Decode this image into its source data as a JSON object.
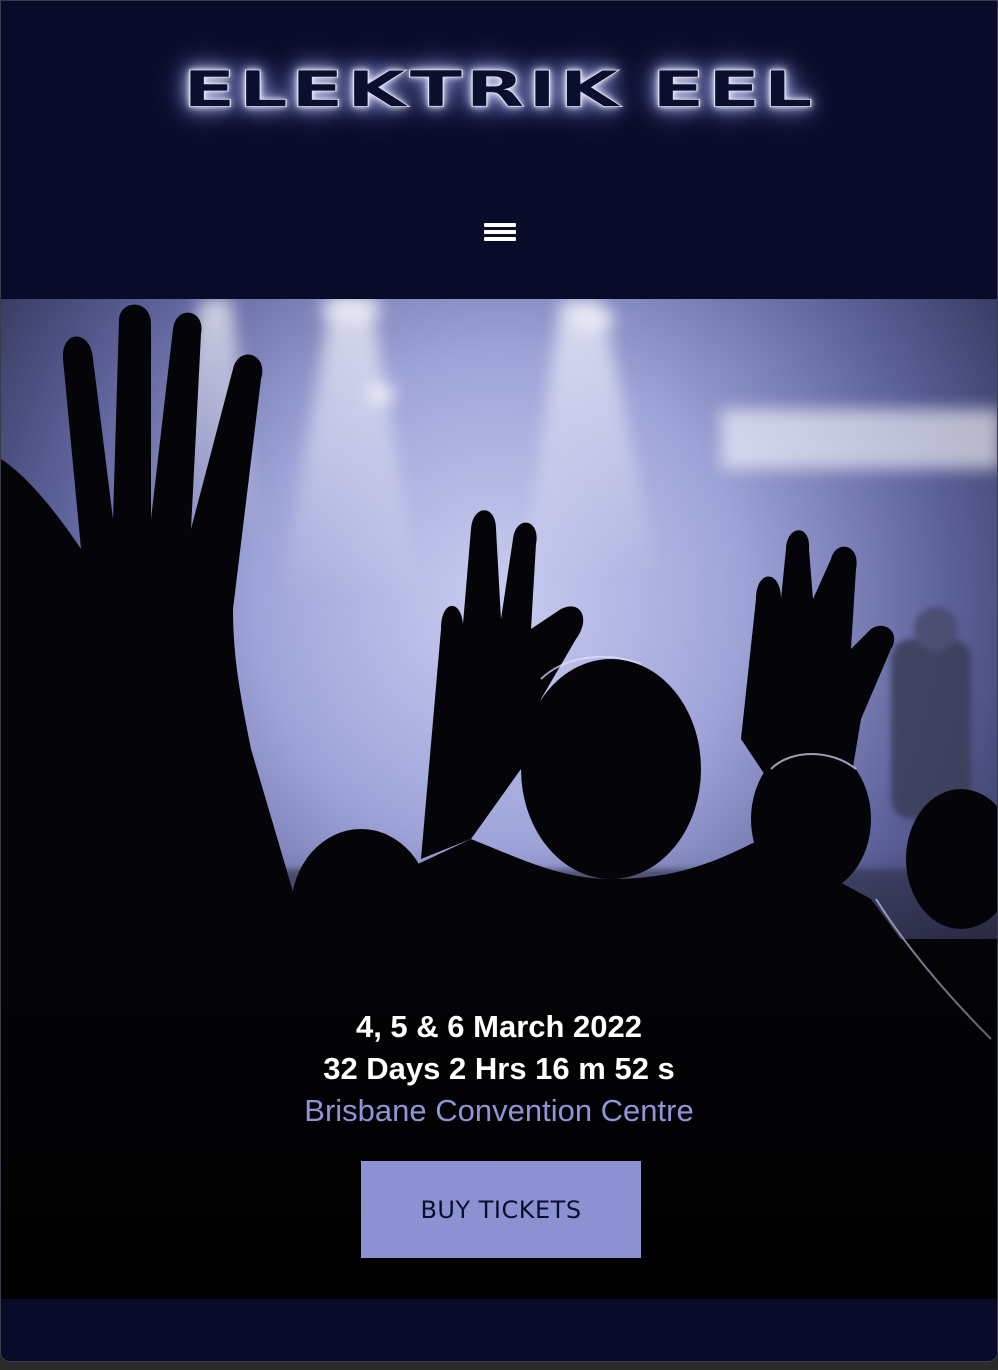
{
  "header": {
    "logo_text": "ELEKTRIK EEL",
    "menu_icon": "hamburger-menu-icon"
  },
  "hero": {
    "image_description_icon": "concert-crowd-image",
    "event_date": "4, 5 & 6 March 2022",
    "countdown": "32 Days 2 Hrs 16 m 52 s",
    "venue": "Brisbane Convention Centre",
    "buy_button_label": "BUY TICKETS"
  },
  "colors": {
    "background": "#090c28",
    "accent": "#8b91d1",
    "venue_text": "#8f94d6",
    "text_primary": "#ffffff"
  }
}
